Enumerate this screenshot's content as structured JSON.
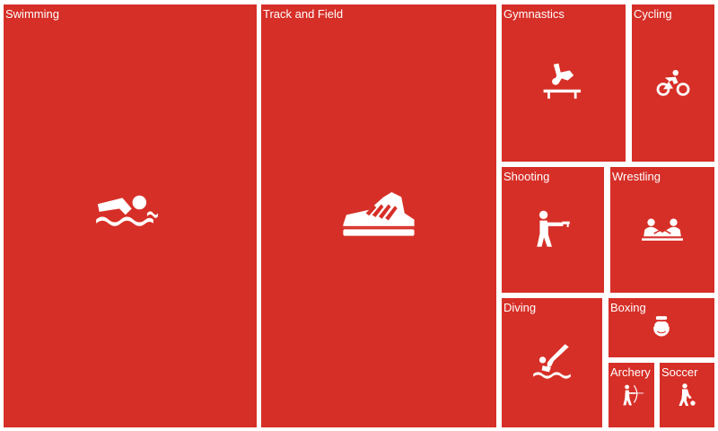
{
  "chart_data": {
    "type": "treemap",
    "colors": {
      "tile": "#d62f27",
      "text": "#ffffff",
      "gap": "#ffffff"
    },
    "items": [
      {
        "name": "Swimming",
        "icon": "swimmer-icon"
      },
      {
        "name": "Track and Field",
        "icon": "sneaker-icon"
      },
      {
        "name": "Gymnastics",
        "icon": "gymnast-icon"
      },
      {
        "name": "Cycling",
        "icon": "cyclist-icon"
      },
      {
        "name": "Shooting",
        "icon": "shooter-icon"
      },
      {
        "name": "Wrestling",
        "icon": "wrestlers-icon"
      },
      {
        "name": "Diving",
        "icon": "diver-icon"
      },
      {
        "name": "Boxing",
        "icon": "boxer-icon"
      },
      {
        "name": "Archery",
        "icon": "archer-icon"
      },
      {
        "name": "Soccer",
        "icon": "soccer-player-icon"
      }
    ]
  }
}
